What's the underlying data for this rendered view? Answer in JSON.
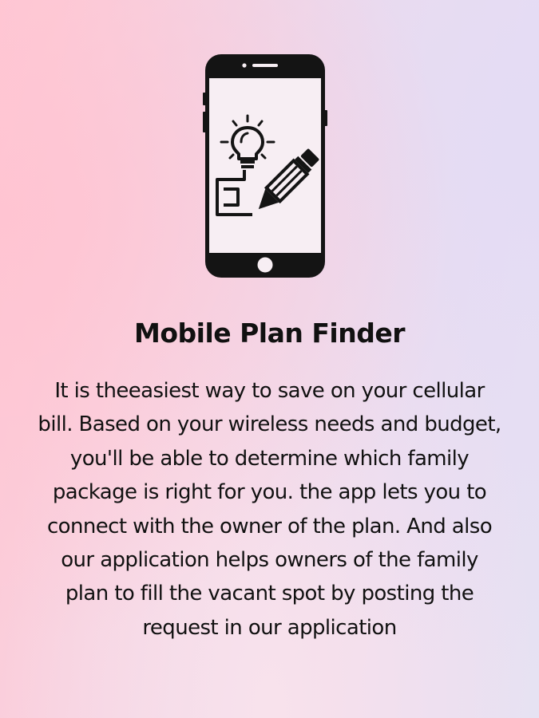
{
  "icons": {
    "phone": "smartphone-icon",
    "idea": "lightbulb-icon",
    "pencil": "pencil-icon"
  },
  "colors": {
    "ink": "#111111",
    "gradient_left": "#ffc9d4",
    "gradient_right": "#e6e2f2"
  },
  "title": "Mobile Plan Finder",
  "description_lines": [
    "It is theeasiest way to save on your cellular",
    "bill. Based on your wireless needs and budget,",
    "you'll be able to determine which family",
    "package is right for you. the app lets you to",
    "connect with the owner of the plan. And also",
    "our application helps owners of the family",
    "plan to fill the vacant spot by posting the",
    "request in our application"
  ]
}
